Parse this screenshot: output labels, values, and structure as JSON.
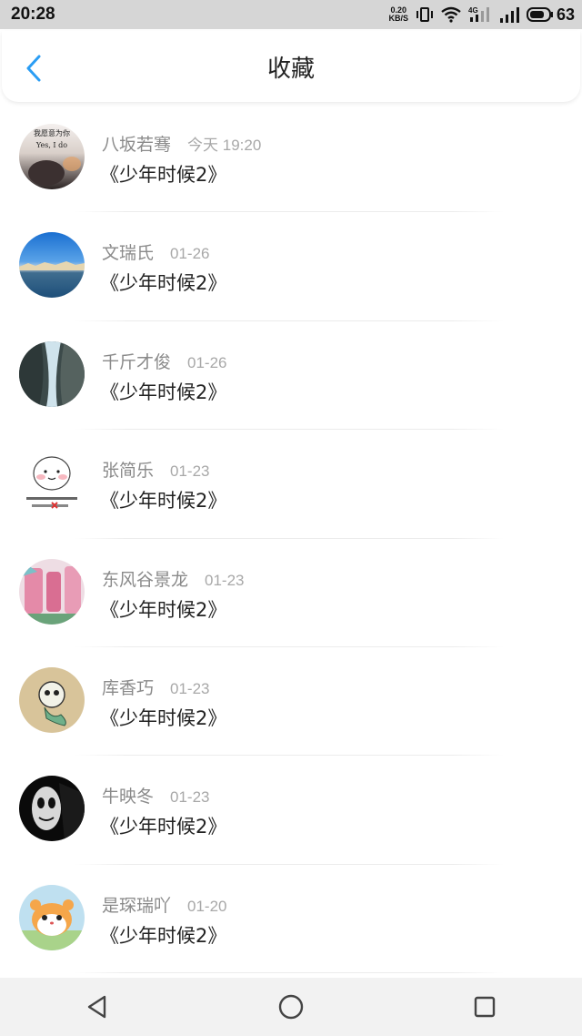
{
  "status_bar": {
    "time": "20:28",
    "net_speed_value": "0.20",
    "net_speed_unit": "KB/S",
    "network_type": "4G",
    "battery": "63"
  },
  "header": {
    "title": "收藏",
    "back_icon": "chevron-left-icon",
    "accent_color": "#2a9df4"
  },
  "favorites": [
    {
      "name": "八坂若骞",
      "time": "今天 19:20",
      "title": "《少年时候2》",
      "avatar_text_top": "我愿意为你",
      "avatar_text_bottom": "Yes, I do"
    },
    {
      "name": "文瑞氏",
      "time": "01-26",
      "title": "《少年时候2》"
    },
    {
      "name": "千斤才俊",
      "time": "01-26",
      "title": "《少年时候2》"
    },
    {
      "name": "张简乐",
      "time": "01-23",
      "title": "《少年时候2》"
    },
    {
      "name": "东风谷景龙",
      "time": "01-23",
      "title": "《少年时候2》"
    },
    {
      "name": "库香巧",
      "time": "01-23",
      "title": "《少年时候2》"
    },
    {
      "name": "牛映冬",
      "time": "01-23",
      "title": "《少年时候2》"
    },
    {
      "name": "是琛瑞吖",
      "time": "01-20",
      "title": "《少年时候2》"
    }
  ],
  "nav_bar": {
    "back": "triangle-back-icon",
    "home": "circle-home-icon",
    "recents": "square-recents-icon"
  }
}
